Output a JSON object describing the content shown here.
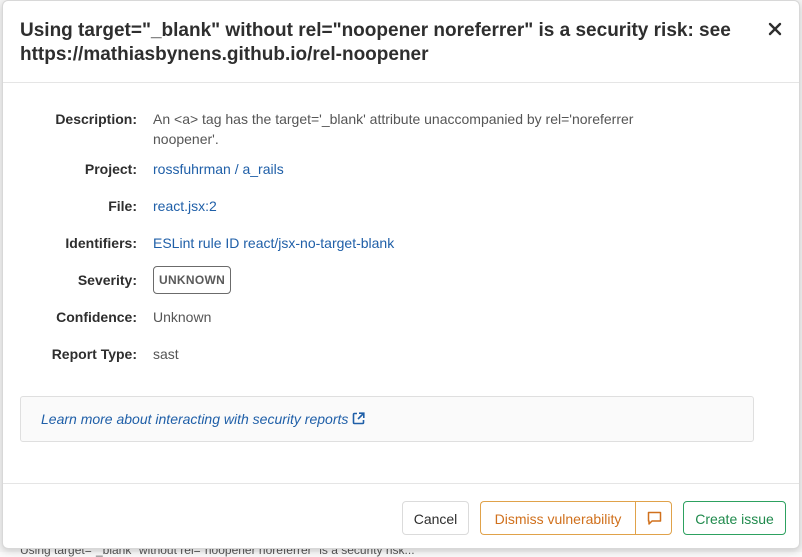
{
  "background": {
    "partial_text": "Using target=\"_blank\" without rel=\"noopener noreferrer\" is a security risk..."
  },
  "modal": {
    "title": "Using target=\"_blank\" without rel=\"noopener noreferrer\" is a security risk: see https://mathiasbynens.github.io/rel-noopener",
    "close_icon": "close-icon"
  },
  "details": {
    "description_label": "Description:",
    "description_value": "An <a> tag has the target='_blank' attribute unaccompanied by rel='noreferrer noopener'.",
    "project_label": "Project:",
    "project_value": "rossfuhrman / a_rails",
    "file_label": "File:",
    "file_value": "react.jsx:2",
    "identifiers_label": "Identifiers:",
    "identifiers_value": "ESLint rule ID react/jsx-no-target-blank",
    "severity_label": "Severity:",
    "severity_value": "UNKNOWN",
    "confidence_label": "Confidence:",
    "confidence_value": "Unknown",
    "report_type_label": "Report Type:",
    "report_type_value": "sast"
  },
  "info": {
    "learn_more_text": "Learn more about interacting with security reports",
    "icon": "external-link-icon"
  },
  "footer": {
    "cancel_label": "Cancel",
    "dismiss_label": "Dismiss vulnerability",
    "comment_icon": "comment-icon",
    "create_issue_label": "Create issue"
  },
  "colors": {
    "link": "#1f5fa8",
    "dismiss": "#d0701c",
    "create": "#1f8a4c"
  }
}
